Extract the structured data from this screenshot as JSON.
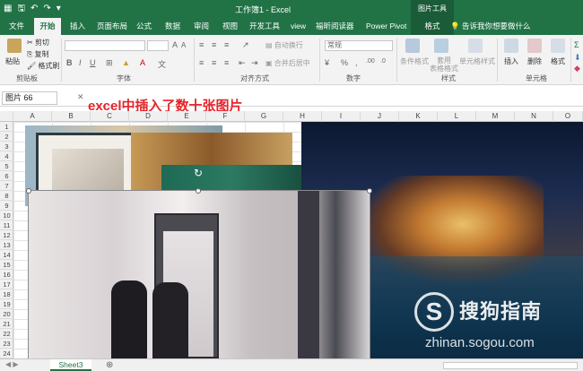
{
  "titlebar": {
    "doc_title": "工作簿1 - Excel",
    "context_title": "图片工具"
  },
  "tabs": [
    {
      "label": "文件"
    },
    {
      "label": "开始"
    },
    {
      "label": "插入"
    },
    {
      "label": "页面布局"
    },
    {
      "label": "公式"
    },
    {
      "label": "数据"
    },
    {
      "label": "审阅"
    },
    {
      "label": "视图"
    },
    {
      "label": "开发工具"
    },
    {
      "label": "view"
    },
    {
      "label": "福昕阅读器"
    },
    {
      "label": "Power Pivot"
    },
    {
      "label": "格式"
    }
  ],
  "tell_me": "告诉我你想要做什么",
  "ribbon": {
    "paste": "粘贴",
    "cut": "剪切",
    "copy": "复制",
    "format_painter": "格式刷",
    "clipboard_label": "剪贴板",
    "font_label": "字体",
    "wrap_text": "自动换行",
    "merge_center": "合并后居中",
    "alignment_label": "对齐方式",
    "number_format": "常规",
    "number_label": "数字",
    "conditional_format": "条件格式",
    "format_as_table": "套用\n表格格式",
    "cell_styles": "单元格样式",
    "styles_label": "样式",
    "insert": "插入",
    "delete": "删除",
    "format": "格式",
    "cells_label": "单元格"
  },
  "formula_bar": {
    "name_box": "图片 66"
  },
  "annotation": "excel中插入了数十张图片",
  "columns": [
    "A",
    "B",
    "C",
    "D",
    "E",
    "F",
    "G",
    "H",
    "I",
    "J",
    "K",
    "L",
    "M",
    "N",
    "O"
  ],
  "rows": [
    "1",
    "2",
    "3",
    "4",
    "5",
    "6",
    "7",
    "8",
    "9",
    "10",
    "11",
    "12",
    "13",
    "14",
    "15",
    "16",
    "17",
    "18",
    "19",
    "20",
    "21",
    "22",
    "23",
    "24"
  ],
  "sheet_tab": "Sheet3",
  "add_sheet": "⊕",
  "watermark": {
    "logo": "S",
    "text": "搜狗指南",
    "url": "zhinan.sogou.com"
  }
}
